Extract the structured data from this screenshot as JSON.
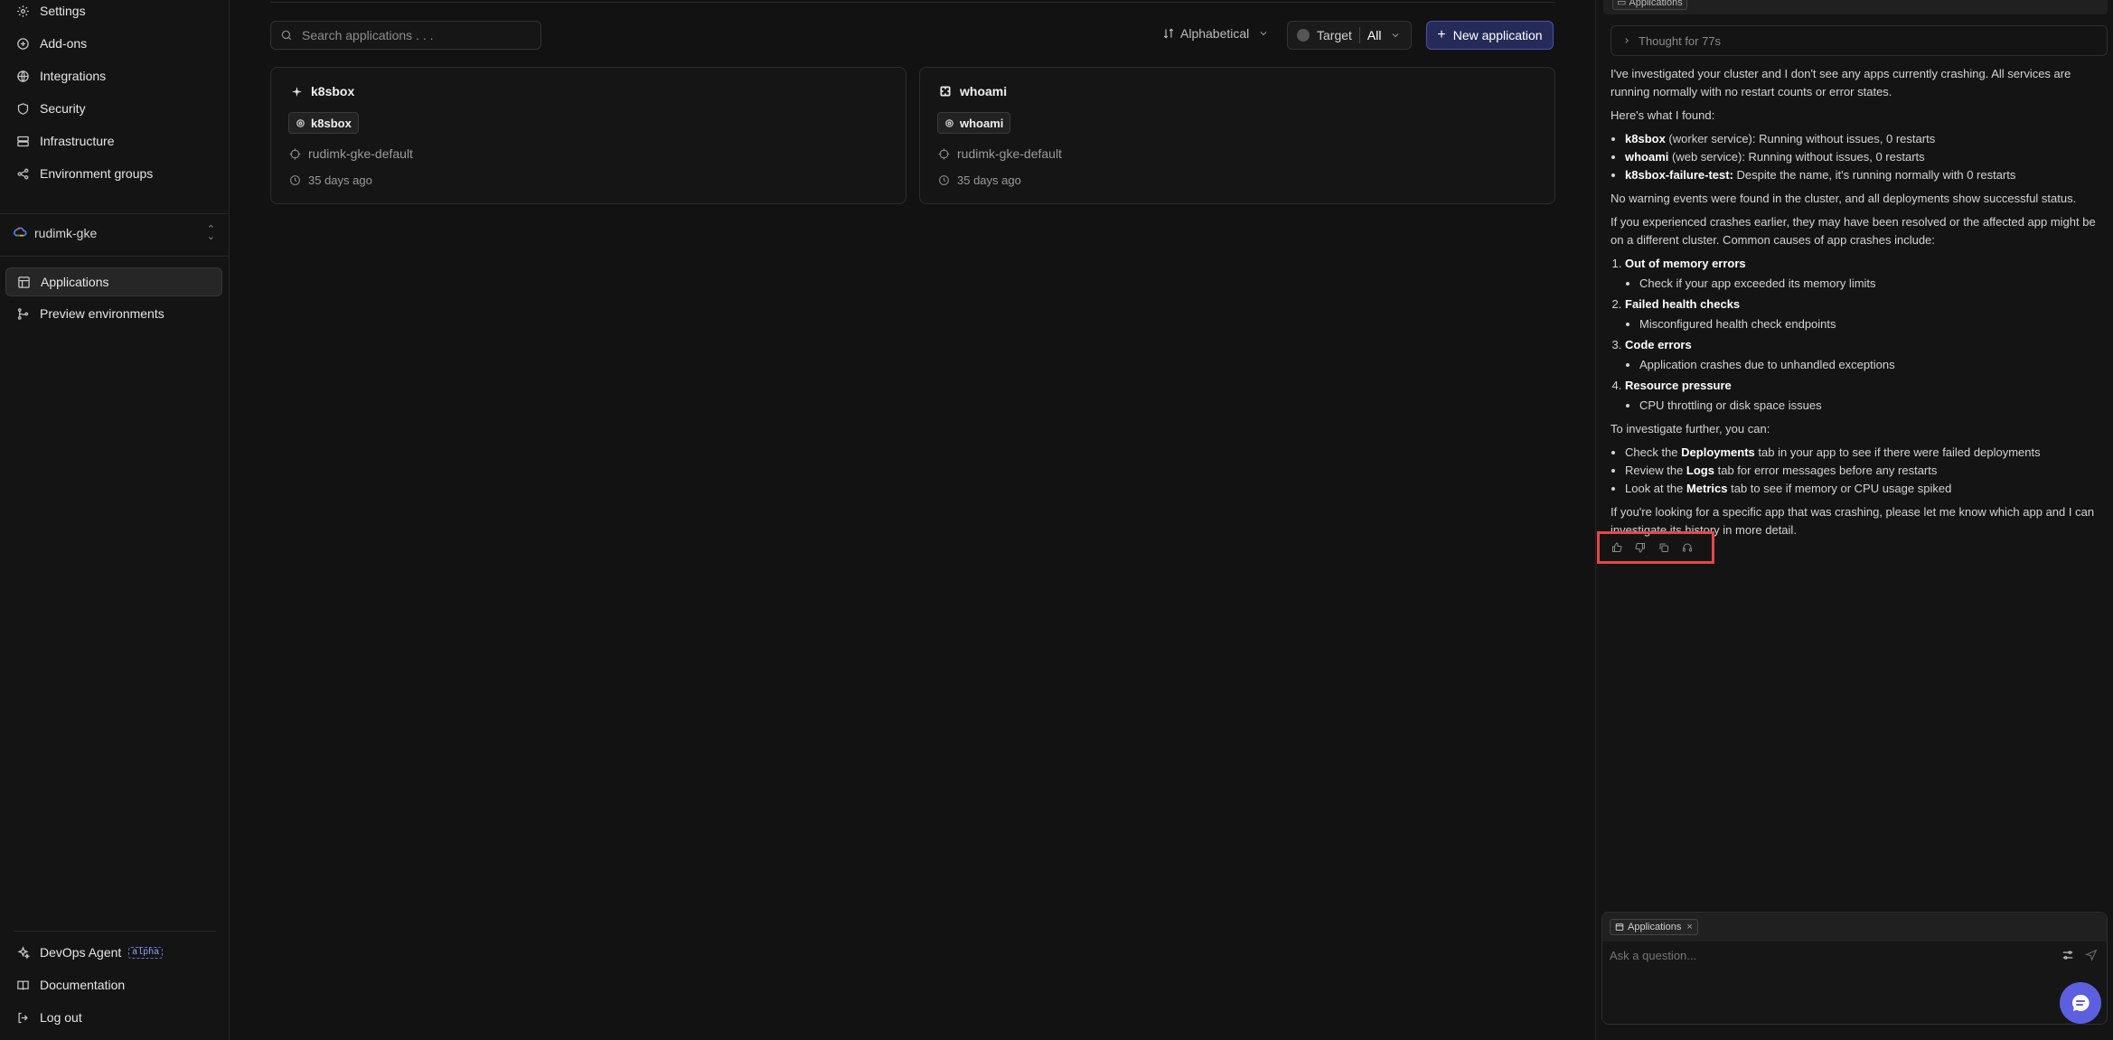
{
  "sidebar": {
    "top_items": [
      {
        "label": "Settings",
        "icon": "gear-icon"
      },
      {
        "label": "Add-ons",
        "icon": "plus-circle-icon"
      },
      {
        "label": "Integrations",
        "icon": "globe-icon"
      },
      {
        "label": "Security",
        "icon": "shield-icon"
      },
      {
        "label": "Infrastructure",
        "icon": "server-icon"
      },
      {
        "label": "Environment groups",
        "icon": "share-icon"
      }
    ],
    "cluster": {
      "name": "rudimk-gke",
      "icon": "google-cloud-icon"
    },
    "env_items": [
      {
        "label": "Applications",
        "icon": "layout-icon",
        "active": true
      },
      {
        "label": "Preview environments",
        "icon": "git-branch-icon",
        "active": false
      }
    ],
    "bottom_items": [
      {
        "label": "DevOps Agent",
        "badge": "alpha",
        "icon": "sparkles-icon"
      },
      {
        "label": "Documentation",
        "icon": "book-icon"
      },
      {
        "label": "Log out",
        "icon": "logout-icon"
      }
    ]
  },
  "toolbar": {
    "search_placeholder": "Search applications . . .",
    "sort_label": "Alphabetical",
    "target_label": "Target",
    "target_value": "All",
    "new_app_label": "New application"
  },
  "apps": [
    {
      "name": "k8sbox",
      "tag": "k8sbox",
      "environment": "rudimk-gke-default",
      "updated": "35 days ago",
      "icon": "worker-icon"
    },
    {
      "name": "whoami",
      "tag": "whoami",
      "environment": "rudimk-gke-default",
      "updated": "35 days ago",
      "icon": "web-service-icon"
    }
  ],
  "assistant": {
    "context_chip": "Applications",
    "thought": "Thought for 77s",
    "p1": "I've investigated your cluster and I don't see any apps currently crashing. All services are running normally with no restart counts or error states.",
    "p2": "Here's what I found:",
    "found": [
      {
        "name": "k8sbox",
        "text": " (worker service): Running without issues, 0 restarts"
      },
      {
        "name": "whoami",
        "text": " (web service): Running without issues, 0 restarts"
      },
      {
        "name": "k8sbox-failure-test:",
        "text": " Despite the name, it's running normally with 0 restarts"
      }
    ],
    "p3": "No warning events were found in the cluster, and all deployments show successful status.",
    "p4": "If you experienced crashes earlier, they may have been resolved or the affected app might be on a different cluster. Common causes of app crashes include:",
    "causes": [
      {
        "title": "Out of memory errors",
        "detail": "Check if your app exceeded its memory limits"
      },
      {
        "title": "Failed health checks",
        "detail": "Misconfigured health check endpoints"
      },
      {
        "title": "Code errors",
        "detail": "Application crashes due to unhandled exceptions"
      },
      {
        "title": "Resource pressure",
        "detail": "CPU throttling or disk space issues"
      }
    ],
    "p5": "To investigate further, you can:",
    "steps": [
      {
        "pre": "Check the ",
        "bold": "Deployments",
        "post": " tab in your app to see if there were failed deployments"
      },
      {
        "pre": "Review the ",
        "bold": "Logs",
        "post": " tab for error messages before any restarts"
      },
      {
        "pre": "Look at the ",
        "bold": "Metrics",
        "post": " tab to see if memory or CPU usage spiked"
      }
    ],
    "p6": "If you're looking for a specific app that was crashing, please let me know which app and I can investigate its history in more detail.",
    "composer_chip": "Applications",
    "composer_placeholder": "Ask a question..."
  }
}
